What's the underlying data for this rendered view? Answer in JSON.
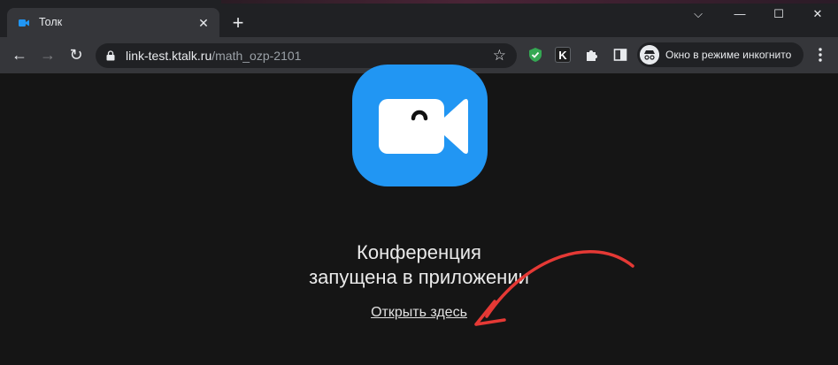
{
  "tab": {
    "title": "Толк",
    "close": "✕",
    "new_tab": "+"
  },
  "window_controls": {
    "dropdown": "⌵",
    "minimize": "—",
    "maximize": "☐",
    "close": "✕"
  },
  "toolbar": {
    "back": "←",
    "forward": "→",
    "reload": "↻",
    "url_host": "link-test.ktalk.ru",
    "url_path": "/math_ozp-2101",
    "bookmark": "☆",
    "k_extension": "K",
    "incognito_label": "Окно в режиме инкогнито"
  },
  "page": {
    "heading_line1": "Конференция",
    "heading_line2": "запущена в приложении",
    "open_link": "Открыть здесь"
  },
  "colors": {
    "brand_blue": "#2196f3",
    "annotation_red": "#e53935",
    "background": "#151515"
  }
}
